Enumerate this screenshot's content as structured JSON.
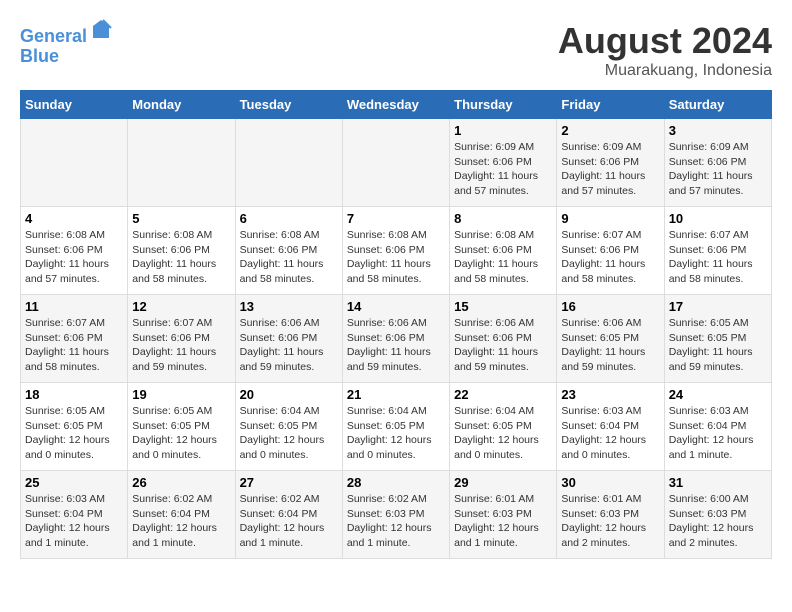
{
  "logo": {
    "line1": "General",
    "line2": "Blue"
  },
  "title": "August 2024",
  "subtitle": "Muarakuang, Indonesia",
  "days_of_week": [
    "Sunday",
    "Monday",
    "Tuesday",
    "Wednesday",
    "Thursday",
    "Friday",
    "Saturday"
  ],
  "weeks": [
    [
      {
        "day": "",
        "info": ""
      },
      {
        "day": "",
        "info": ""
      },
      {
        "day": "",
        "info": ""
      },
      {
        "day": "",
        "info": ""
      },
      {
        "day": "1",
        "info": "Sunrise: 6:09 AM\nSunset: 6:06 PM\nDaylight: 11 hours\nand 57 minutes."
      },
      {
        "day": "2",
        "info": "Sunrise: 6:09 AM\nSunset: 6:06 PM\nDaylight: 11 hours\nand 57 minutes."
      },
      {
        "day": "3",
        "info": "Sunrise: 6:09 AM\nSunset: 6:06 PM\nDaylight: 11 hours\nand 57 minutes."
      }
    ],
    [
      {
        "day": "4",
        "info": "Sunrise: 6:08 AM\nSunset: 6:06 PM\nDaylight: 11 hours\nand 57 minutes."
      },
      {
        "day": "5",
        "info": "Sunrise: 6:08 AM\nSunset: 6:06 PM\nDaylight: 11 hours\nand 58 minutes."
      },
      {
        "day": "6",
        "info": "Sunrise: 6:08 AM\nSunset: 6:06 PM\nDaylight: 11 hours\nand 58 minutes."
      },
      {
        "day": "7",
        "info": "Sunrise: 6:08 AM\nSunset: 6:06 PM\nDaylight: 11 hours\nand 58 minutes."
      },
      {
        "day": "8",
        "info": "Sunrise: 6:08 AM\nSunset: 6:06 PM\nDaylight: 11 hours\nand 58 minutes."
      },
      {
        "day": "9",
        "info": "Sunrise: 6:07 AM\nSunset: 6:06 PM\nDaylight: 11 hours\nand 58 minutes."
      },
      {
        "day": "10",
        "info": "Sunrise: 6:07 AM\nSunset: 6:06 PM\nDaylight: 11 hours\nand 58 minutes."
      }
    ],
    [
      {
        "day": "11",
        "info": "Sunrise: 6:07 AM\nSunset: 6:06 PM\nDaylight: 11 hours\nand 58 minutes."
      },
      {
        "day": "12",
        "info": "Sunrise: 6:07 AM\nSunset: 6:06 PM\nDaylight: 11 hours\nand 59 minutes."
      },
      {
        "day": "13",
        "info": "Sunrise: 6:06 AM\nSunset: 6:06 PM\nDaylight: 11 hours\nand 59 minutes."
      },
      {
        "day": "14",
        "info": "Sunrise: 6:06 AM\nSunset: 6:06 PM\nDaylight: 11 hours\nand 59 minutes."
      },
      {
        "day": "15",
        "info": "Sunrise: 6:06 AM\nSunset: 6:06 PM\nDaylight: 11 hours\nand 59 minutes."
      },
      {
        "day": "16",
        "info": "Sunrise: 6:06 AM\nSunset: 6:05 PM\nDaylight: 11 hours\nand 59 minutes."
      },
      {
        "day": "17",
        "info": "Sunrise: 6:05 AM\nSunset: 6:05 PM\nDaylight: 11 hours\nand 59 minutes."
      }
    ],
    [
      {
        "day": "18",
        "info": "Sunrise: 6:05 AM\nSunset: 6:05 PM\nDaylight: 12 hours\nand 0 minutes."
      },
      {
        "day": "19",
        "info": "Sunrise: 6:05 AM\nSunset: 6:05 PM\nDaylight: 12 hours\nand 0 minutes."
      },
      {
        "day": "20",
        "info": "Sunrise: 6:04 AM\nSunset: 6:05 PM\nDaylight: 12 hours\nand 0 minutes."
      },
      {
        "day": "21",
        "info": "Sunrise: 6:04 AM\nSunset: 6:05 PM\nDaylight: 12 hours\nand 0 minutes."
      },
      {
        "day": "22",
        "info": "Sunrise: 6:04 AM\nSunset: 6:05 PM\nDaylight: 12 hours\nand 0 minutes."
      },
      {
        "day": "23",
        "info": "Sunrise: 6:03 AM\nSunset: 6:04 PM\nDaylight: 12 hours\nand 0 minutes."
      },
      {
        "day": "24",
        "info": "Sunrise: 6:03 AM\nSunset: 6:04 PM\nDaylight: 12 hours\nand 1 minute."
      }
    ],
    [
      {
        "day": "25",
        "info": "Sunrise: 6:03 AM\nSunset: 6:04 PM\nDaylight: 12 hours\nand 1 minute."
      },
      {
        "day": "26",
        "info": "Sunrise: 6:02 AM\nSunset: 6:04 PM\nDaylight: 12 hours\nand 1 minute."
      },
      {
        "day": "27",
        "info": "Sunrise: 6:02 AM\nSunset: 6:04 PM\nDaylight: 12 hours\nand 1 minute."
      },
      {
        "day": "28",
        "info": "Sunrise: 6:02 AM\nSunset: 6:03 PM\nDaylight: 12 hours\nand 1 minute."
      },
      {
        "day": "29",
        "info": "Sunrise: 6:01 AM\nSunset: 6:03 PM\nDaylight: 12 hours\nand 1 minute."
      },
      {
        "day": "30",
        "info": "Sunrise: 6:01 AM\nSunset: 6:03 PM\nDaylight: 12 hours\nand 2 minutes."
      },
      {
        "day": "31",
        "info": "Sunrise: 6:00 AM\nSunset: 6:03 PM\nDaylight: 12 hours\nand 2 minutes."
      }
    ]
  ]
}
